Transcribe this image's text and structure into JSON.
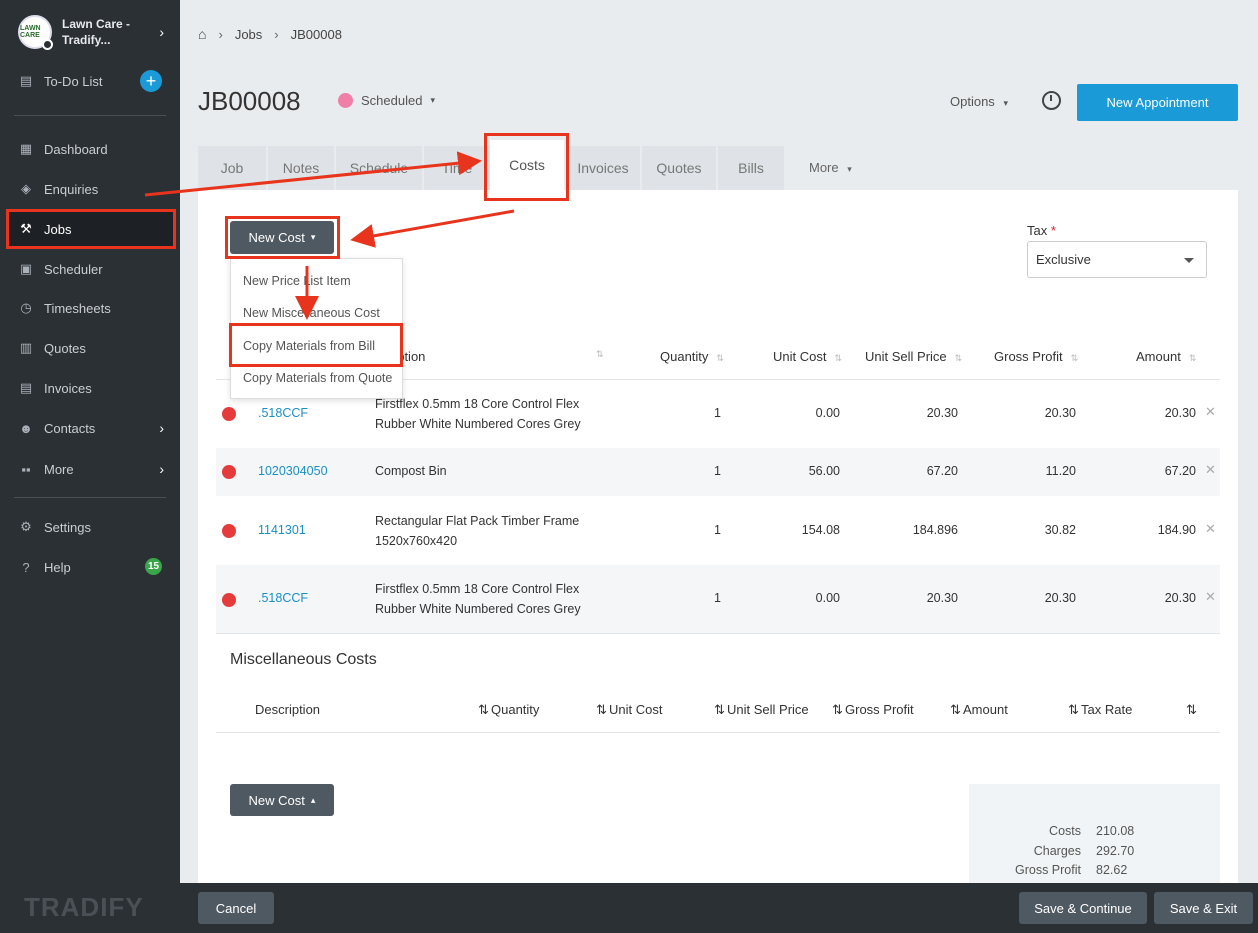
{
  "sidebar": {
    "account_name": "Lawn Care - Tradify...",
    "logo_text": "LAWN CARE",
    "todo_label": "To-Do List",
    "items": [
      {
        "label": "Dashboard",
        "icon": "dashboard-icon"
      },
      {
        "label": "Enquiries",
        "icon": "tag-icon"
      },
      {
        "label": "Jobs",
        "icon": "hammer-icon"
      },
      {
        "label": "Scheduler",
        "icon": "calendar-icon"
      },
      {
        "label": "Timesheets",
        "icon": "clock-icon"
      },
      {
        "label": "Quotes",
        "icon": "calculator-icon"
      },
      {
        "label": "Invoices",
        "icon": "invoice-icon"
      },
      {
        "label": "Contacts",
        "icon": "users-icon"
      },
      {
        "label": "More",
        "icon": "grid-icon"
      },
      {
        "label": "Settings",
        "icon": "gear-icon"
      },
      {
        "label": "Help",
        "icon": "question-icon"
      }
    ],
    "help_badge": "15",
    "brand_footer": "TRADIFY"
  },
  "breadcrumb": {
    "jobs": "Jobs",
    "current": "JB00008"
  },
  "header": {
    "job_number": "JB00008",
    "status": "Scheduled",
    "options_label": "Options",
    "new_appointment_label": "New Appointment",
    "status_color": "#f07fa7",
    "accent_color": "#1a9bd7"
  },
  "tabs": [
    "Job",
    "Notes",
    "Schedule",
    "Time",
    "Costs",
    "Invoices",
    "Quotes",
    "Bills"
  ],
  "tabs_more": "More",
  "costs": {
    "new_cost_label": "New Cost",
    "dropdown": [
      "New Price List Item",
      "New Miscellaneous Cost",
      "Copy Materials from Bill",
      "Copy Materials from Quote"
    ],
    "tax_label": "Tax",
    "tax_required": "*",
    "tax_value": "Exclusive",
    "columns": {
      "description": "Description",
      "quantity": "Quantity",
      "unit_cost": "Unit Cost",
      "unit_sell_price": "Unit Sell Price",
      "gross_profit": "Gross Profit",
      "amount": "Amount"
    },
    "header_desc_visible": "ription",
    "rows": [
      {
        "code": ".518CCF",
        "desc1": "Firstflex 0.5mm 18 Core Control Flex",
        "desc2": "Rubber White Numbered Cores Grey",
        "qty": "1",
        "unit_cost": "0.00",
        "sell": "20.30",
        "gp": "20.30",
        "amount": "20.30"
      },
      {
        "code": "1020304050",
        "desc1": "Compost Bin",
        "desc2": "",
        "qty": "1",
        "unit_cost": "56.00",
        "sell": "67.20",
        "gp": "11.20",
        "amount": "67.20"
      },
      {
        "code": "1141301",
        "desc1": "Rectangular Flat Pack Timber Frame",
        "desc2": "1520x760x420",
        "qty": "1",
        "unit_cost": "154.08",
        "sell": "184.896",
        "gp": "30.82",
        "amount": "184.90"
      },
      {
        "code": ".518CCF",
        "desc1": "Firstflex 0.5mm 18 Core Control Flex",
        "desc2": "Rubber White Numbered Cores Grey",
        "qty": "1",
        "unit_cost": "0.00",
        "sell": "20.30",
        "gp": "20.30",
        "amount": "20.30"
      }
    ],
    "misc_title": "Miscellaneous Costs",
    "misc_columns": {
      "description": "Description",
      "quantity": "Quantity",
      "unit_cost": "Unit Cost",
      "unit_sell_price": "Unit Sell Price",
      "gross_profit": "Gross Profit",
      "amount": "Amount",
      "tax_rate": "Tax Rate"
    },
    "summary": {
      "costs_label": "Costs",
      "costs": "210.08",
      "charges_label": "Charges",
      "charges": "292.70",
      "gp_label": "Gross Profit",
      "gp": "82.62"
    }
  },
  "footer": {
    "cancel": "Cancel",
    "save_continue": "Save & Continue",
    "save_exit": "Save & Exit"
  }
}
